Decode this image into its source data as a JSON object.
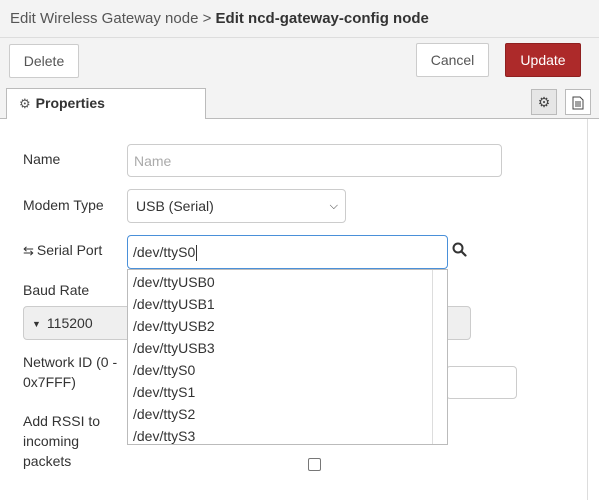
{
  "breadcrumb": {
    "parent": "Edit Wireless Gateway node",
    "separator": ">",
    "current": "Edit ncd-gateway-config node"
  },
  "toolbar": {
    "delete_label": "Delete",
    "cancel_label": "Cancel",
    "update_label": "Update"
  },
  "tabs": {
    "properties_label": "Properties"
  },
  "form": {
    "name": {
      "label": "Name",
      "placeholder": "Name",
      "value": ""
    },
    "modem_type": {
      "label": "Modem Type",
      "value": "USB (Serial)"
    },
    "serial_port": {
      "label": "Serial Port",
      "value": "/dev/ttyS0"
    },
    "baud_rate": {
      "label": "Baud Rate",
      "value": "115200"
    },
    "network_id": {
      "label_line1": "Network ID (0 -",
      "label_line2": "0x7FFF)"
    },
    "rssi": {
      "label_line1": "Add RSSI to",
      "label_line2": "incoming",
      "label_line3": "packets"
    }
  },
  "serial_options": [
    "/dev/ttyUSB0",
    "/dev/ttyUSB1",
    "/dev/ttyUSB2",
    "/dev/ttyUSB3",
    "/dev/ttyS0",
    "/dev/ttyS1",
    "/dev/ttyS2",
    "/dev/ttyS3"
  ],
  "colors": {
    "accent_update": "#ad2a2a",
    "focus_border": "#4a90d9"
  }
}
